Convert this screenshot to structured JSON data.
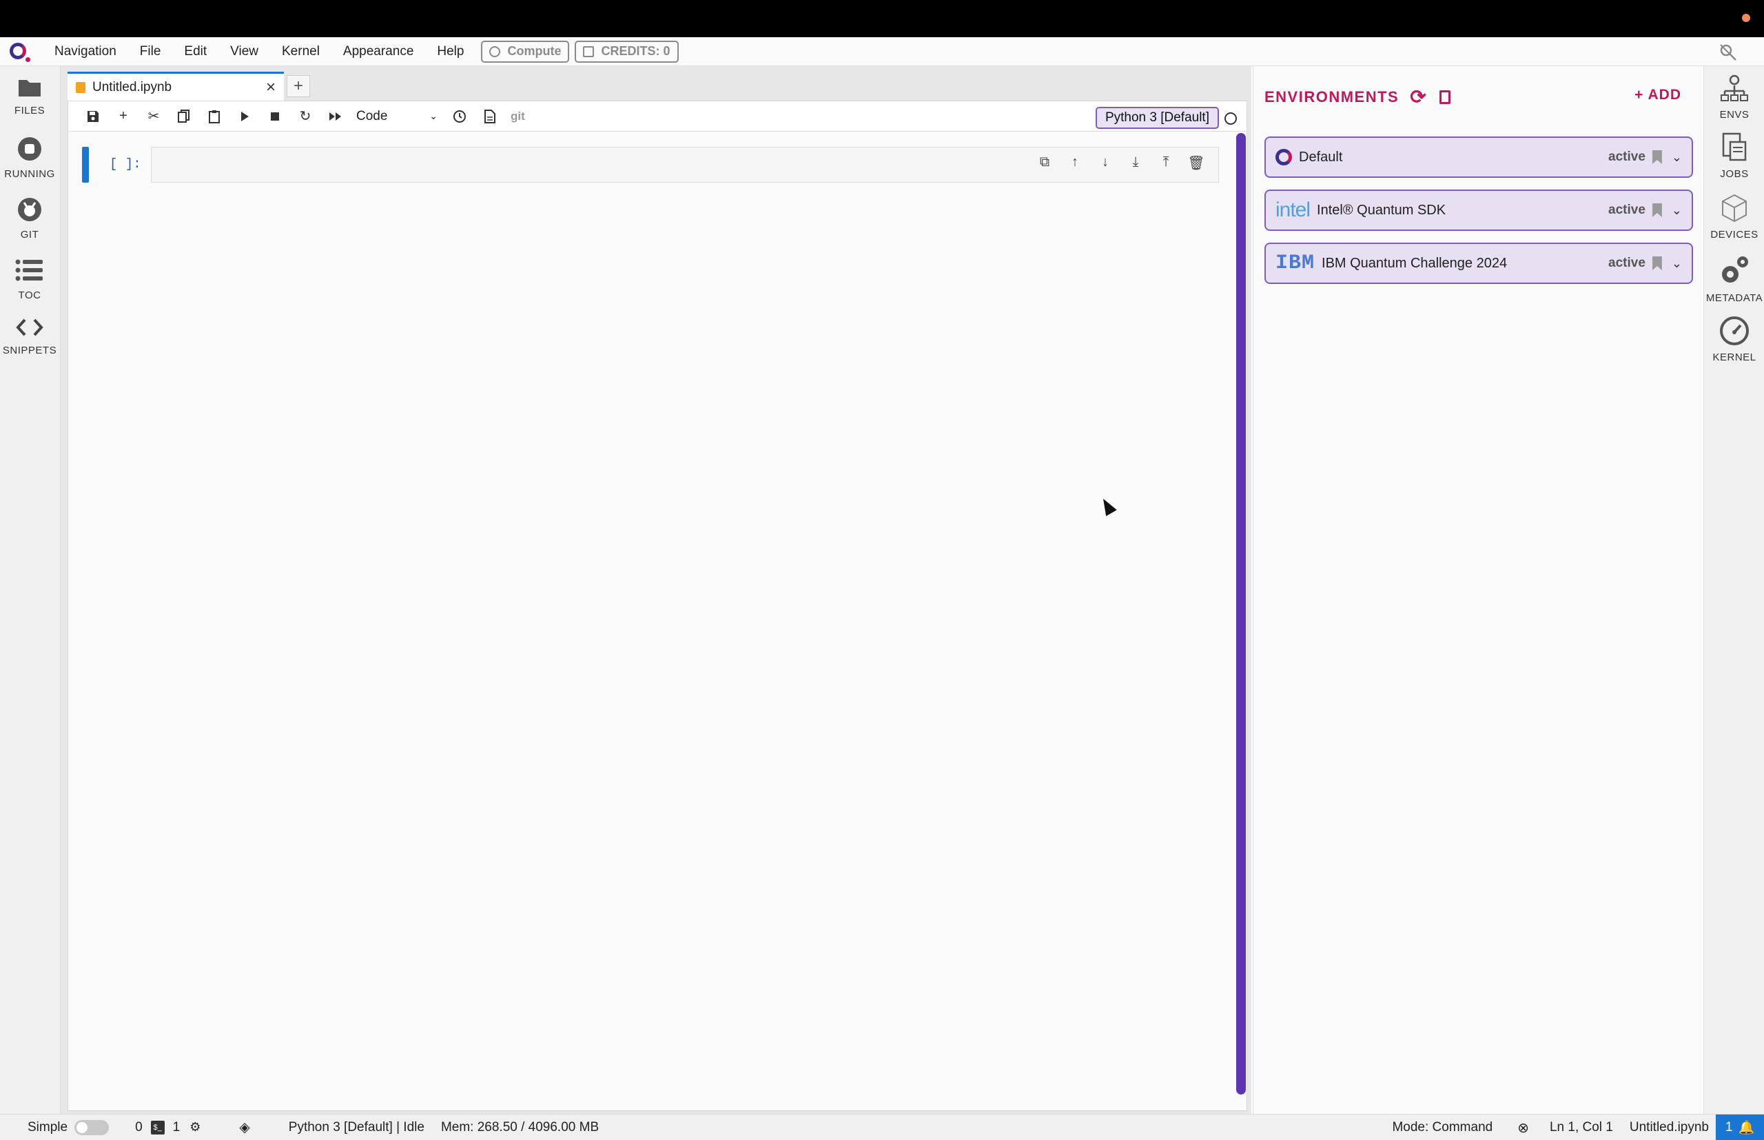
{
  "menubar": {
    "items": [
      "Navigation",
      "File",
      "Edit",
      "View",
      "Kernel",
      "Appearance",
      "Help"
    ],
    "compute_label": "Compute",
    "credits_label": "CREDITS:",
    "credits_value": "0"
  },
  "left_sidebar": {
    "items": [
      {
        "label": "FILES",
        "icon": "folder-icon"
      },
      {
        "label": "RUNNING",
        "icon": "stop-circle-icon"
      },
      {
        "label": "GIT",
        "icon": "git-icon"
      },
      {
        "label": "TOC",
        "icon": "list-icon"
      },
      {
        "label": "SNIPPETS",
        "icon": "code-icon"
      }
    ]
  },
  "tab": {
    "title": "Untitled.ipynb"
  },
  "toolbar": {
    "cell_type": "Code",
    "git_label": "git",
    "kernel_name": "Python 3 [Default]"
  },
  "cell": {
    "prompt": "[ ]:"
  },
  "environments": {
    "title": "ENVIRONMENTS",
    "add_label": "+ ADD",
    "items": [
      {
        "name": "Default",
        "logo": "",
        "status": "active"
      },
      {
        "name": "Intel® Quantum SDK",
        "logo": "intel",
        "status": "active"
      },
      {
        "name": "IBM Quantum Challenge 2024",
        "logo": "IBM",
        "status": "active"
      }
    ]
  },
  "right_sidebar": {
    "items": [
      {
        "label": "ENVS",
        "icon": "envs-icon"
      },
      {
        "label": "JOBS",
        "icon": "jobs-icon"
      },
      {
        "label": "DEVICES",
        "icon": "cube-icon"
      },
      {
        "label": "METADATA",
        "icon": "gears-icon"
      },
      {
        "label": "KERNEL",
        "icon": "gauge-icon"
      }
    ]
  },
  "statusbar": {
    "mode_label": "Simple",
    "count_a": "0",
    "count_b": "1",
    "kernel_status": "Python 3 [Default] | Idle",
    "memory": "Mem: 268.50 / 4096.00 MB",
    "mode": "Mode: Command",
    "position": "Ln 1, Col 1",
    "filename": "Untitled.ipynb",
    "notifications": "1"
  }
}
